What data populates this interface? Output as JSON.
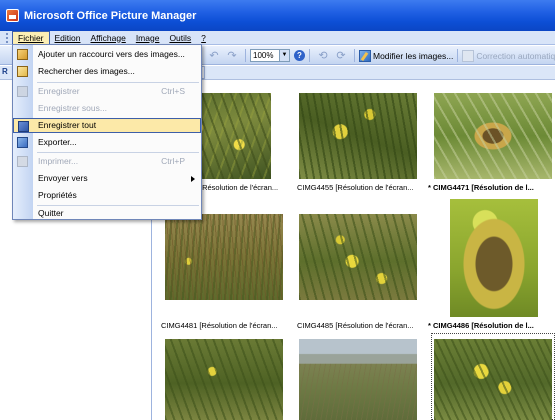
{
  "window": {
    "title": "Microsoft Office Picture Manager"
  },
  "menubar": {
    "items": [
      {
        "label": "Fichier",
        "open": true
      },
      {
        "label": "Edition"
      },
      {
        "label": "Affichage"
      },
      {
        "label": "Image"
      },
      {
        "label": "Outils"
      },
      {
        "label": "?"
      }
    ]
  },
  "file_menu": {
    "items": [
      {
        "label": "Ajouter un raccourci vers des images...",
        "shortcut": "",
        "disabled": false,
        "icon": "folder-shortcut-icon"
      },
      {
        "label": "Rechercher des images...",
        "shortcut": "",
        "disabled": false,
        "icon": "search-images-icon"
      },
      {
        "label": "Enregistrer",
        "shortcut": "Ctrl+S",
        "disabled": true,
        "icon": "save-icon"
      },
      {
        "label": "Enregistrer sous...",
        "shortcut": "",
        "disabled": true,
        "icon": ""
      },
      {
        "label": "Enregistrer tout",
        "shortcut": "",
        "disabled": false,
        "icon": "save-all-icon",
        "highlighted": true
      },
      {
        "label": "Exporter...",
        "shortcut": "",
        "disabled": false,
        "icon": "export-icon"
      },
      {
        "label": "Imprimer...",
        "shortcut": "Ctrl+P",
        "disabled": true,
        "icon": "print-icon"
      },
      {
        "label": "Envoyer vers",
        "shortcut": "",
        "disabled": false,
        "icon": "",
        "submenu": true
      },
      {
        "label": "Propriétés",
        "shortcut": "",
        "disabled": false,
        "icon": ""
      },
      {
        "label": "Quitter",
        "shortcut": "",
        "disabled": false,
        "icon": ""
      }
    ]
  },
  "toolbar": {
    "zoom_value": "100%",
    "edit_images_label": "Modifier les images...",
    "auto_correct_label": "Correction automatique"
  },
  "thumbnails": [
    {
      "caption": "[Résolution de l'écran...",
      "bold": false,
      "texture": "p1"
    },
    {
      "caption": "CIMG4455 [Résolution de l'écran...",
      "bold": false,
      "texture": "p2"
    },
    {
      "caption": "* CIMG4471 [Résolution de l...",
      "bold": true,
      "texture": "p3"
    },
    {
      "caption": "CIMG4481 [Résolution de l'écran...",
      "bold": false,
      "texture": "p5"
    },
    {
      "caption": "CIMG4485 [Résolution de l'écran...",
      "bold": false,
      "texture": "p6"
    },
    {
      "caption": "* CIMG4486 [Résolution de l...",
      "bold": true,
      "texture": "p4"
    },
    {
      "caption": "",
      "bold": false,
      "texture": "p7"
    },
    {
      "caption": "",
      "bold": false,
      "texture": "p8"
    },
    {
      "caption": "",
      "bold": false,
      "texture": "p9"
    }
  ]
}
